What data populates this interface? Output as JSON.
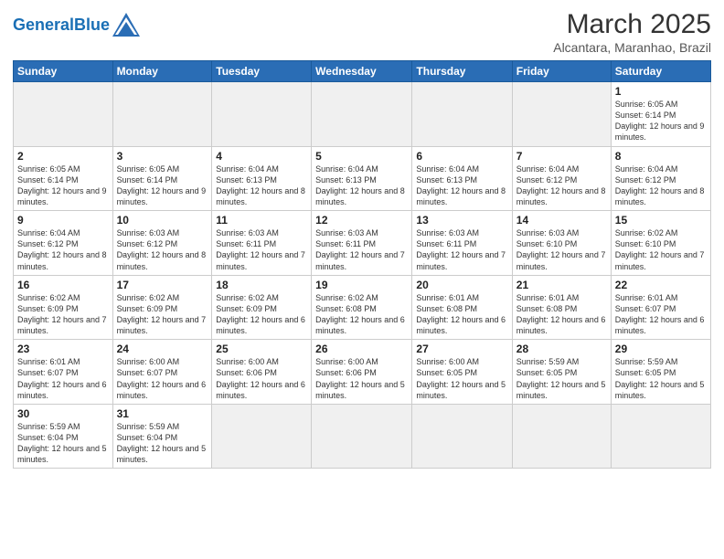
{
  "header": {
    "logo_general": "General",
    "logo_blue": "Blue",
    "month_year": "March 2025",
    "location": "Alcantara, Maranhao, Brazil"
  },
  "days_of_week": [
    "Sunday",
    "Monday",
    "Tuesday",
    "Wednesday",
    "Thursday",
    "Friday",
    "Saturday"
  ],
  "weeks": [
    [
      {
        "day": "",
        "info": ""
      },
      {
        "day": "",
        "info": ""
      },
      {
        "day": "",
        "info": ""
      },
      {
        "day": "",
        "info": ""
      },
      {
        "day": "",
        "info": ""
      },
      {
        "day": "",
        "info": ""
      },
      {
        "day": "1",
        "info": "Sunrise: 6:05 AM\nSunset: 6:14 PM\nDaylight: 12 hours and 9 minutes."
      }
    ],
    [
      {
        "day": "2",
        "info": "Sunrise: 6:05 AM\nSunset: 6:14 PM\nDaylight: 12 hours and 9 minutes."
      },
      {
        "day": "3",
        "info": "Sunrise: 6:05 AM\nSunset: 6:14 PM\nDaylight: 12 hours and 9 minutes."
      },
      {
        "day": "4",
        "info": "Sunrise: 6:04 AM\nSunset: 6:13 PM\nDaylight: 12 hours and 8 minutes."
      },
      {
        "day": "5",
        "info": "Sunrise: 6:04 AM\nSunset: 6:13 PM\nDaylight: 12 hours and 8 minutes."
      },
      {
        "day": "6",
        "info": "Sunrise: 6:04 AM\nSunset: 6:13 PM\nDaylight: 12 hours and 8 minutes."
      },
      {
        "day": "7",
        "info": "Sunrise: 6:04 AM\nSunset: 6:12 PM\nDaylight: 12 hours and 8 minutes."
      },
      {
        "day": "8",
        "info": "Sunrise: 6:04 AM\nSunset: 6:12 PM\nDaylight: 12 hours and 8 minutes."
      }
    ],
    [
      {
        "day": "9",
        "info": "Sunrise: 6:04 AM\nSunset: 6:12 PM\nDaylight: 12 hours and 8 minutes."
      },
      {
        "day": "10",
        "info": "Sunrise: 6:03 AM\nSunset: 6:12 PM\nDaylight: 12 hours and 8 minutes."
      },
      {
        "day": "11",
        "info": "Sunrise: 6:03 AM\nSunset: 6:11 PM\nDaylight: 12 hours and 7 minutes."
      },
      {
        "day": "12",
        "info": "Sunrise: 6:03 AM\nSunset: 6:11 PM\nDaylight: 12 hours and 7 minutes."
      },
      {
        "day": "13",
        "info": "Sunrise: 6:03 AM\nSunset: 6:11 PM\nDaylight: 12 hours and 7 minutes."
      },
      {
        "day": "14",
        "info": "Sunrise: 6:03 AM\nSunset: 6:10 PM\nDaylight: 12 hours and 7 minutes."
      },
      {
        "day": "15",
        "info": "Sunrise: 6:02 AM\nSunset: 6:10 PM\nDaylight: 12 hours and 7 minutes."
      }
    ],
    [
      {
        "day": "16",
        "info": "Sunrise: 6:02 AM\nSunset: 6:09 PM\nDaylight: 12 hours and 7 minutes."
      },
      {
        "day": "17",
        "info": "Sunrise: 6:02 AM\nSunset: 6:09 PM\nDaylight: 12 hours and 7 minutes."
      },
      {
        "day": "18",
        "info": "Sunrise: 6:02 AM\nSunset: 6:09 PM\nDaylight: 12 hours and 6 minutes."
      },
      {
        "day": "19",
        "info": "Sunrise: 6:02 AM\nSunset: 6:08 PM\nDaylight: 12 hours and 6 minutes."
      },
      {
        "day": "20",
        "info": "Sunrise: 6:01 AM\nSunset: 6:08 PM\nDaylight: 12 hours and 6 minutes."
      },
      {
        "day": "21",
        "info": "Sunrise: 6:01 AM\nSunset: 6:08 PM\nDaylight: 12 hours and 6 minutes."
      },
      {
        "day": "22",
        "info": "Sunrise: 6:01 AM\nSunset: 6:07 PM\nDaylight: 12 hours and 6 minutes."
      }
    ],
    [
      {
        "day": "23",
        "info": "Sunrise: 6:01 AM\nSunset: 6:07 PM\nDaylight: 12 hours and 6 minutes."
      },
      {
        "day": "24",
        "info": "Sunrise: 6:00 AM\nSunset: 6:07 PM\nDaylight: 12 hours and 6 minutes."
      },
      {
        "day": "25",
        "info": "Sunrise: 6:00 AM\nSunset: 6:06 PM\nDaylight: 12 hours and 6 minutes."
      },
      {
        "day": "26",
        "info": "Sunrise: 6:00 AM\nSunset: 6:06 PM\nDaylight: 12 hours and 5 minutes."
      },
      {
        "day": "27",
        "info": "Sunrise: 6:00 AM\nSunset: 6:05 PM\nDaylight: 12 hours and 5 minutes."
      },
      {
        "day": "28",
        "info": "Sunrise: 5:59 AM\nSunset: 6:05 PM\nDaylight: 12 hours and 5 minutes."
      },
      {
        "day": "29",
        "info": "Sunrise: 5:59 AM\nSunset: 6:05 PM\nDaylight: 12 hours and 5 minutes."
      }
    ],
    [
      {
        "day": "30",
        "info": "Sunrise: 5:59 AM\nSunset: 6:04 PM\nDaylight: 12 hours and 5 minutes."
      },
      {
        "day": "31",
        "info": "Sunrise: 5:59 AM\nSunset: 6:04 PM\nDaylight: 12 hours and 5 minutes."
      },
      {
        "day": "",
        "info": ""
      },
      {
        "day": "",
        "info": ""
      },
      {
        "day": "",
        "info": ""
      },
      {
        "day": "",
        "info": ""
      },
      {
        "day": "",
        "info": ""
      }
    ]
  ]
}
